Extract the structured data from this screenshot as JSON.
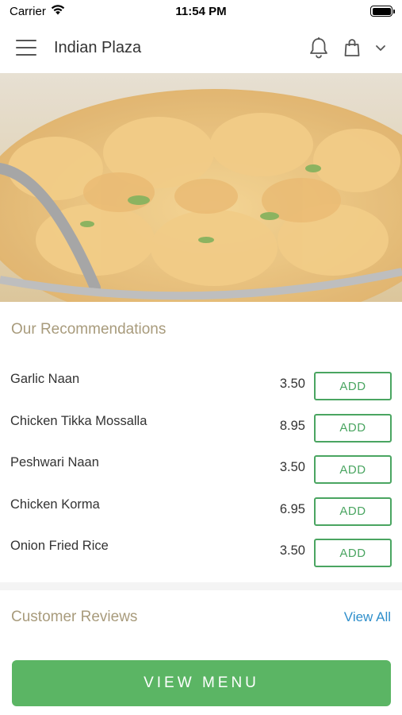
{
  "status_bar": {
    "carrier": "Carrier",
    "time": "11:54 PM"
  },
  "header": {
    "title": "Indian Plaza",
    "icons": [
      "menu-icon",
      "bell-icon",
      "shopping-bag-icon",
      "chevron-down-icon"
    ]
  },
  "recommendations": {
    "title": "Our Recommendations",
    "items": [
      {
        "name": "Garlic Naan",
        "price": "3.50",
        "add_label": "ADD"
      },
      {
        "name": "Chicken Tikka Mossalla",
        "price": "8.95",
        "add_label": "ADD"
      },
      {
        "name": "Peshwari Naan",
        "price": "3.50",
        "add_label": "ADD"
      },
      {
        "name": "Chicken Korma",
        "price": "6.95",
        "add_label": "ADD"
      },
      {
        "name": "Onion Fried Rice",
        "price": "3.50",
        "add_label": "ADD"
      }
    ]
  },
  "reviews": {
    "title": "Customer Reviews",
    "view_all_label": "View All"
  },
  "footer": {
    "view_menu_label": "VIEW MENU"
  },
  "colors": {
    "accent_green": "#5bb564",
    "add_border": "#4aa561",
    "section_title": "#a89b7c",
    "link_blue": "#2f8fcb"
  }
}
